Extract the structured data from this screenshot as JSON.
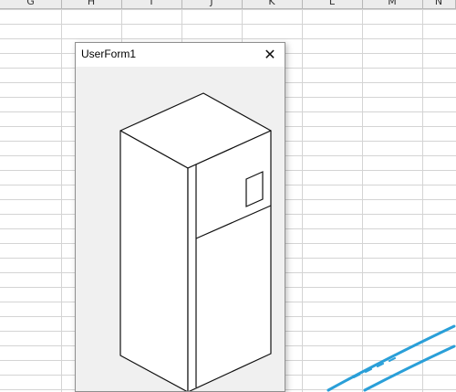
{
  "spreadsheet": {
    "columns": [
      "G",
      "H",
      "I",
      "J",
      "K",
      "L",
      "M",
      "N"
    ]
  },
  "userform": {
    "title": "UserForm1",
    "close_glyph": "✕",
    "drawing_icon": "refrigerator-drawing"
  },
  "colors": {
    "form_background": "#f0f0f0",
    "grid_line": "#d4d4d4",
    "watermark_blue": "#2a9fd8"
  }
}
